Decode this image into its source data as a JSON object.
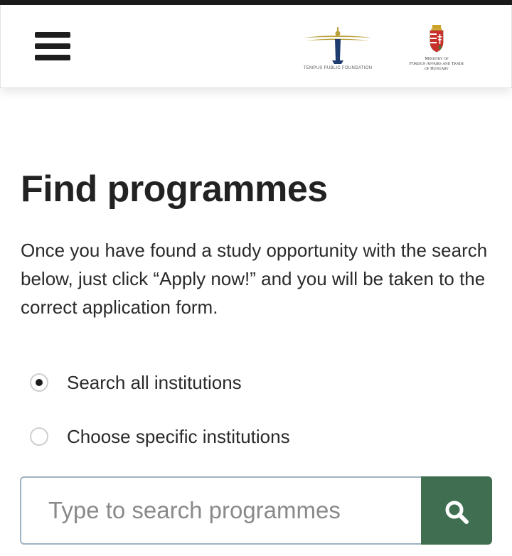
{
  "header": {
    "menu_icon": "hamburger-menu-icon",
    "tempus_logo": {
      "caption": "TEMPUS PUBLIC FOUNDATION",
      "colors": {
        "navy": "#1f3c6e",
        "gold": "#b9a03a"
      }
    },
    "ministry_logo": {
      "caption_lines": [
        "Ministry of",
        "Foreign Affairs and Trade",
        "of Hungary"
      ]
    }
  },
  "main": {
    "title": "Find programmes",
    "intro": "Once you have found a study opportunity with the search below, just click “Apply now!” and you will be taken to the correct application form.",
    "options": [
      {
        "label": "Search all institutions",
        "selected": true
      },
      {
        "label": "Choose specific institutions",
        "selected": false
      }
    ],
    "search": {
      "placeholder": "Type to search programmes",
      "value": "",
      "button_icon": "search-icon",
      "button_color": "#3f6e50"
    }
  }
}
